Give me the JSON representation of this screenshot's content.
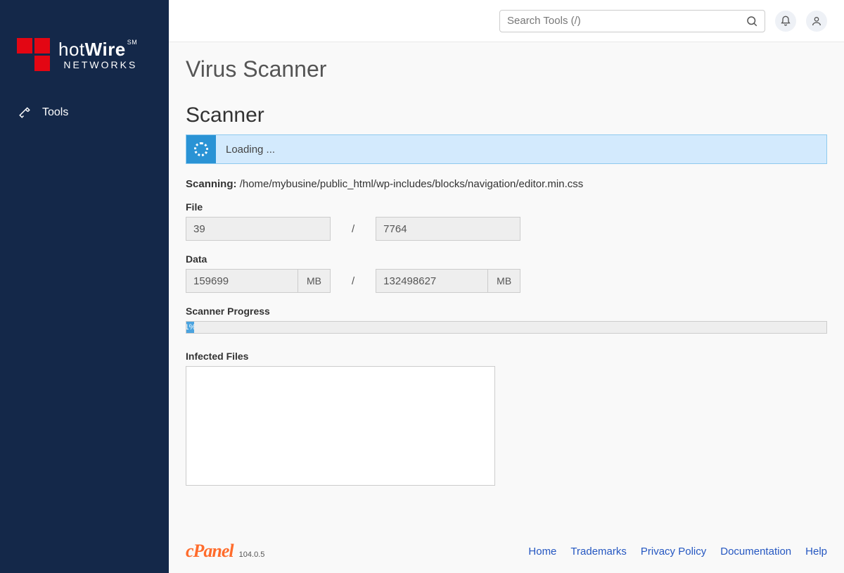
{
  "brand": {
    "name_thin": "hot",
    "name_bold": "Wire",
    "sub": "NETWORKS",
    "mark": "SM"
  },
  "sidebar": {
    "tools_label": "Tools"
  },
  "topbar": {
    "search_placeholder": "Search Tools (/)"
  },
  "page": {
    "title": "Virus Scanner",
    "section": "Scanner"
  },
  "loading": {
    "text": "Loading ..."
  },
  "scanning": {
    "label": "Scanning:",
    "path": "/home/mybusine/public_html/wp-includes/blocks/navigation/editor.min.css"
  },
  "file": {
    "label": "File",
    "current": "39",
    "sep": "/",
    "total": "7764"
  },
  "data": {
    "label": "Data",
    "current": "159699",
    "unit": "MB",
    "sep": "/",
    "total": "132498627",
    "unit2": "MB"
  },
  "progress": {
    "label": "Scanner Progress",
    "text": "1%",
    "width": "1.2%"
  },
  "infected": {
    "label": "Infected Files",
    "value": ""
  },
  "footer": {
    "cpanel": "cPanel",
    "version": "104.0.5",
    "links": [
      "Home",
      "Trademarks",
      "Privacy Policy",
      "Documentation",
      "Help"
    ]
  }
}
